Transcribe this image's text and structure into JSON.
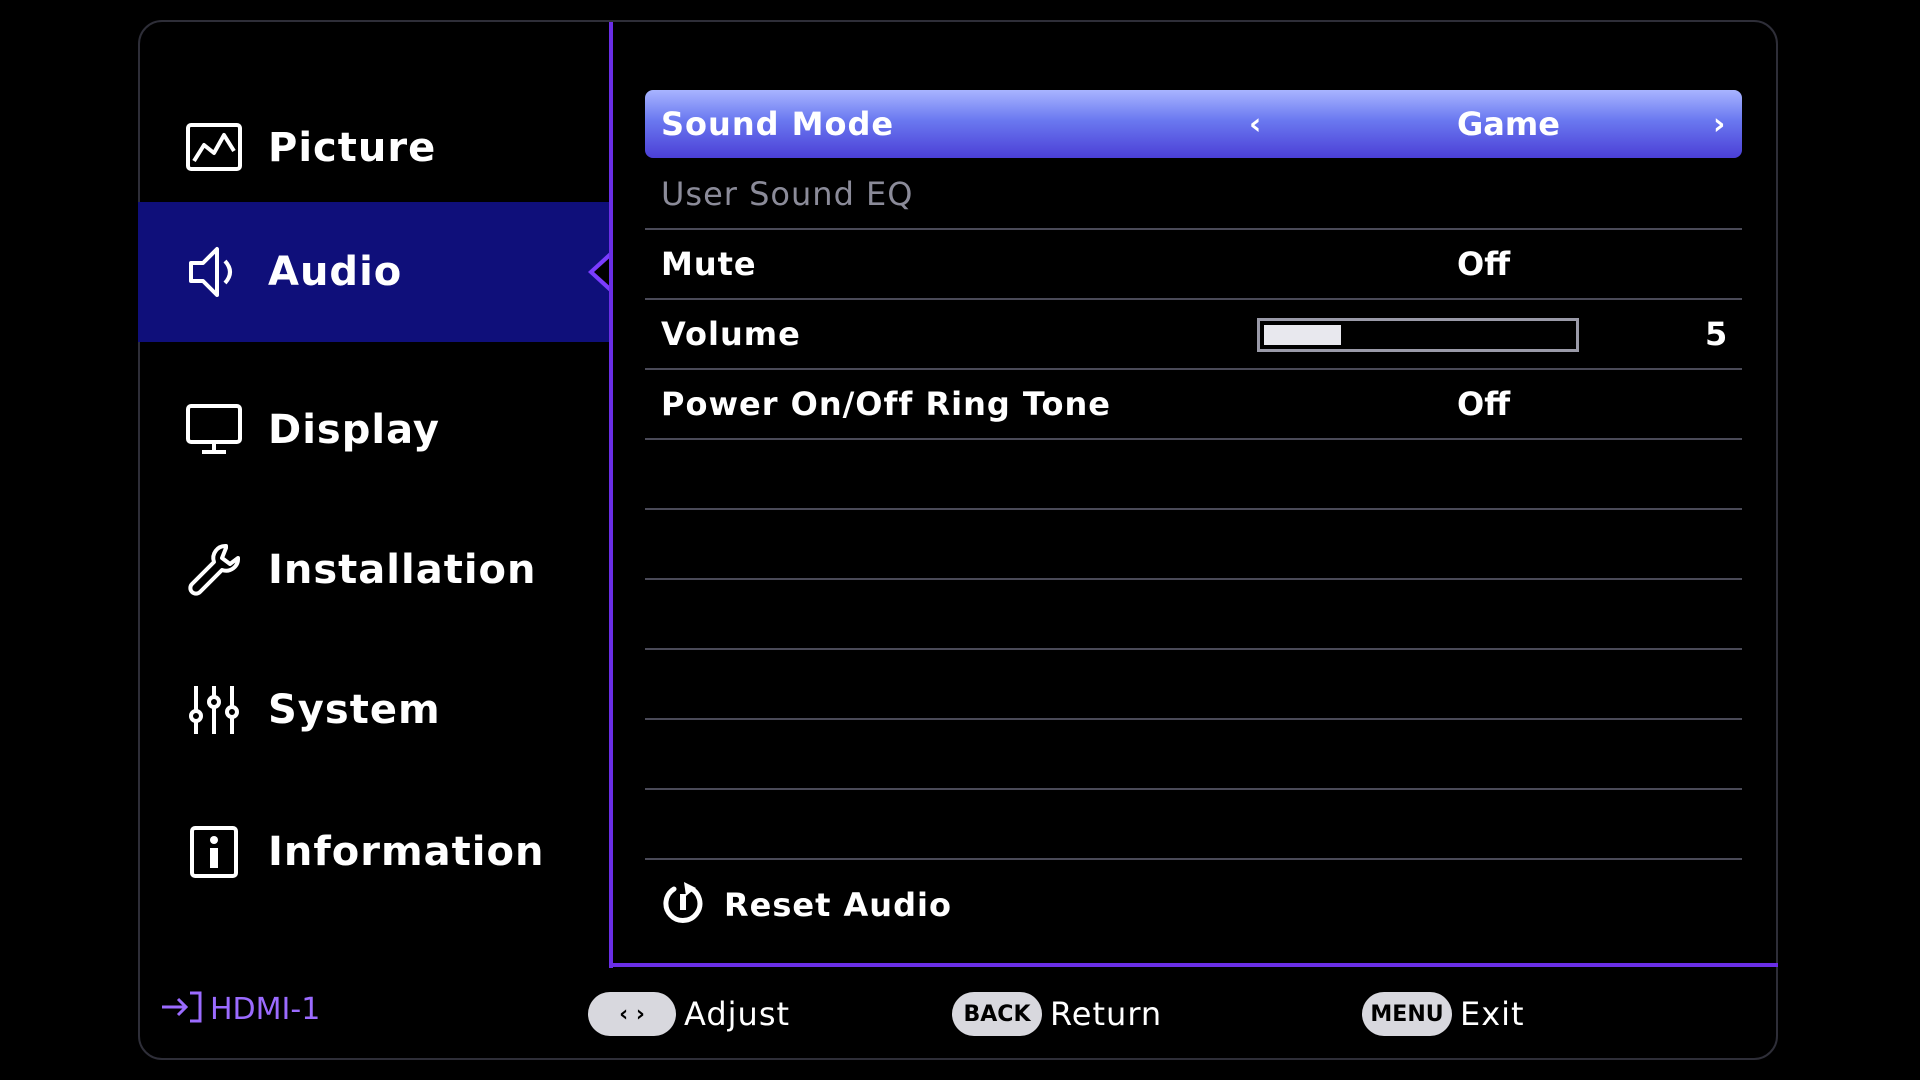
{
  "sidebar": {
    "items": [
      {
        "label": "Picture",
        "icon": "picture-icon"
      },
      {
        "label": "Audio",
        "icon": "speaker-icon"
      },
      {
        "label": "Display",
        "icon": "monitor-icon"
      },
      {
        "label": "Installation",
        "icon": "wrench-icon"
      },
      {
        "label": "System",
        "icon": "sliders-icon"
      },
      {
        "label": "Information",
        "icon": "info-icon"
      }
    ],
    "active": "Audio"
  },
  "audio": {
    "sound_mode": {
      "label": "Sound Mode",
      "value": "Game",
      "prev": "‹",
      "next": "›"
    },
    "user_sound_eq": {
      "label": "User Sound EQ"
    },
    "mute": {
      "label": "Mute",
      "value": "Off"
    },
    "volume": {
      "label": "Volume",
      "value": "5",
      "level_fraction": 0.25
    },
    "ring_tone": {
      "label": "Power On/Off Ring Tone",
      "value": "Off"
    },
    "reset": {
      "label": "Reset Audio"
    }
  },
  "footer": {
    "input": "HDMI-1",
    "adjust_key": "‹ ›",
    "adjust_label": "Adjust",
    "back_key": "BACK",
    "back_label": "Return",
    "menu_key": "MENU",
    "menu_label": "Exit"
  },
  "colors": {
    "accent": "#6a2ee6",
    "active_item": "#0f0f7a",
    "selected_row": "#5a5ae0"
  }
}
